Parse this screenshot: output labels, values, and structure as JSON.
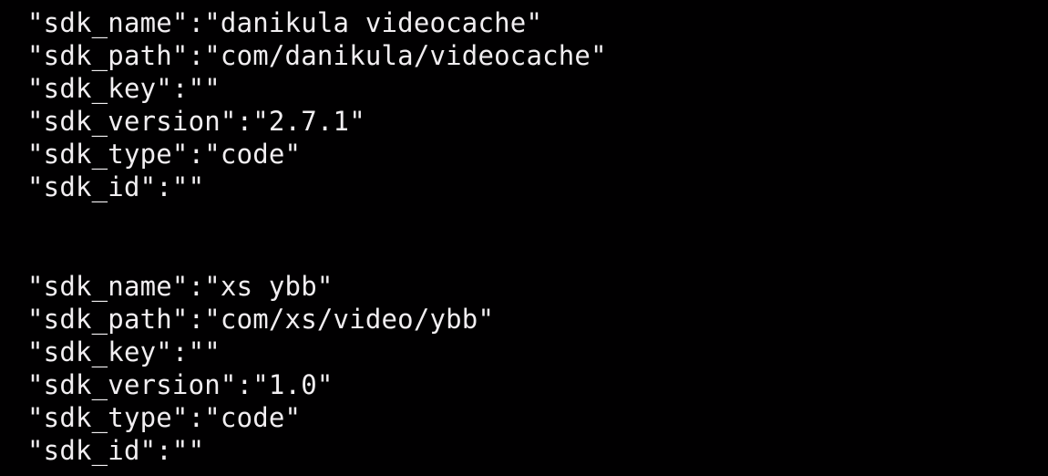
{
  "colors": {
    "background": "#010001",
    "text": "#f1eef1"
  },
  "blocks": [
    {
      "lines": [
        "\"sdk_name\":\"danikula videocache\"",
        "\"sdk_path\":\"com/danikula/videocache\"",
        "\"sdk_key\":\"\"",
        "\"sdk_version\":\"2.7.1\"",
        "\"sdk_type\":\"code\"",
        "\"sdk_id\":\"\""
      ]
    },
    {
      "lines": [
        "\"sdk_name\":\"xs ybb\"",
        "\"sdk_path\":\"com/xs/video/ybb\"",
        "\"sdk_key\":\"\"",
        "\"sdk_version\":\"1.0\"",
        "\"sdk_type\":\"code\"",
        "\"sdk_id\":\"\""
      ]
    }
  ]
}
